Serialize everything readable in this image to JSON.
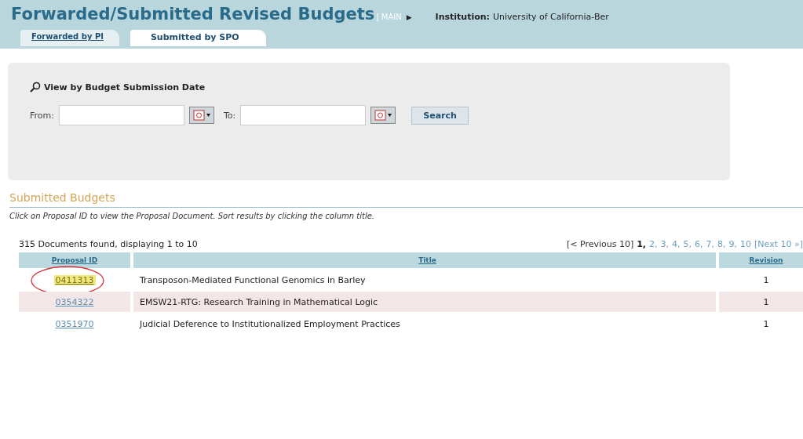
{
  "header": {
    "title": "Forwarded/Submitted Revised Budgets",
    "main_link": "| MAIN",
    "arrow": "▶",
    "institution_label": "Institution:",
    "institution": "University of California-Ber"
  },
  "tabs": [
    {
      "label": "Forwarded by PI",
      "selected": false
    },
    {
      "label": "Submitted by SPO",
      "selected": true
    }
  ],
  "search_panel": {
    "title": "View by Budget Submission Date",
    "from_label": "From:",
    "to_label": "To:",
    "button": "Search"
  },
  "section": {
    "title": "Submitted Budgets",
    "instructions": "Click on Proposal ID to view the Proposal Document. Sort results by clicking the column title."
  },
  "results": {
    "count": "315 Documents found, displaying 1 to 10",
    "previous": {
      "label": "[< Previous 10]",
      "disabled": true
    },
    "pages": [
      {
        "label": "1,",
        "selected": true
      },
      {
        "label": "2,",
        "selected": false
      },
      {
        "label": "3,",
        "selected": false
      },
      {
        "label": "4,",
        "selected": false
      },
      {
        "label": "5,",
        "selected": false
      },
      {
        "label": "6,",
        "selected": false
      },
      {
        "label": "7,",
        "selected": false
      },
      {
        "label": "8,",
        "selected": false
      },
      {
        "label": "9,",
        "selected": false
      },
      {
        "label": "10",
        "selected": false
      }
    ],
    "next": {
      "label": "[Next 10 »]",
      "disabled": false
    }
  },
  "table": {
    "columns": [
      "Proposal ID",
      "Title",
      "Revision"
    ],
    "rows": [
      {
        "id": "0411313",
        "title": "Transposon-Mediated Functional Genomics in Barley",
        "revision": "1",
        "selected": true
      },
      {
        "id": "0354322",
        "title": "EMSW21-RTG: Research Training in Mathematical Logic",
        "revision": "1",
        "selected": false
      },
      {
        "id": "0351970",
        "title": "Judicial Deference to Institutionalized Employment Practices",
        "revision": "1",
        "selected": false
      }
    ]
  }
}
